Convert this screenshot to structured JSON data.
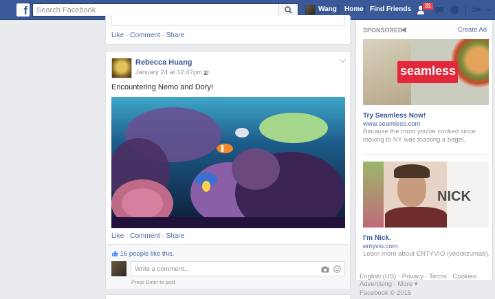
{
  "search": {
    "placeholder": "Search Facebook"
  },
  "nav": {
    "user": "Wang",
    "home": "Home",
    "find_friends": "Find Friends",
    "friend_badge": "31"
  },
  "top_post": {
    "like": "Like",
    "comment": "Comment",
    "share": "Share"
  },
  "post": {
    "author": "Rebecca Huang",
    "date": "January 24 at 12:47pm",
    "text": "Encountering Nemo and Dory!",
    "actions": {
      "like": "Like",
      "comment": "Comment",
      "share": "Share"
    },
    "likes": "16 people like this.",
    "comment_placeholder": "Write a comment...",
    "press_enter": "Press Enter to post."
  },
  "sponsored": {
    "label": "SPONSORED",
    "create_ad": "Create Ad",
    "ads": [
      {
        "brand_text": "seamless",
        "title": "Try Seamless Now!",
        "url": "www.seamless.com",
        "desc": "Because the most you've cooked since moving to NY was toasting a bagel."
      },
      {
        "brand_text": "NICK",
        "title": "I'm Nick.",
        "url": "entyvio.com",
        "desc": "Learn more about ENTYVIO (vedolizumab)."
      }
    ]
  },
  "footer": {
    "links": [
      "English (US)",
      "Privacy",
      "Terms",
      "Cookies",
      "Advertising",
      "More"
    ],
    "copyright": "Facebook © 2015"
  },
  "colors": {
    "brand": "#3b5998",
    "link": "#4b67a1",
    "badge": "#fa3e3e"
  }
}
